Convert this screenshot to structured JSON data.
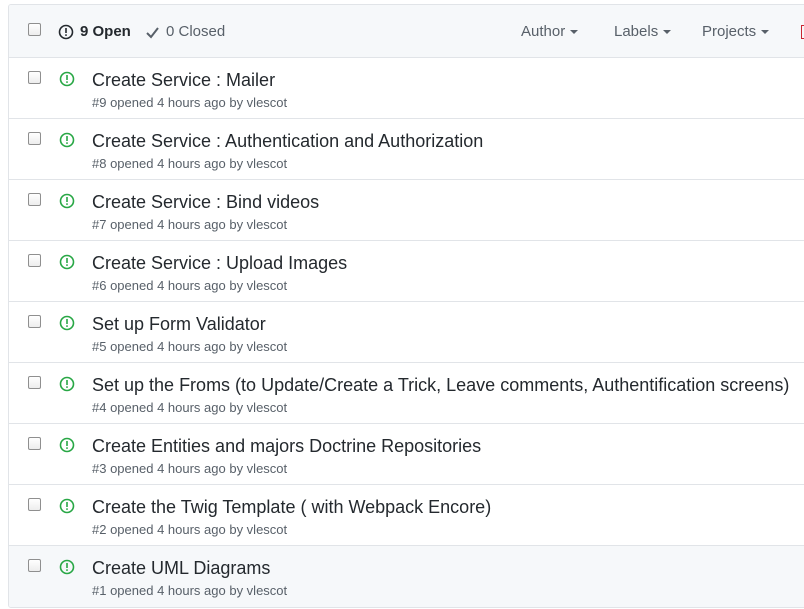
{
  "header": {
    "open_label": "9 Open",
    "closed_label": "0 Closed",
    "filters": {
      "author": "Author",
      "labels": "Labels",
      "projects": "Projects"
    }
  },
  "colors": {
    "open_icon": "#28a745",
    "header_bg": "#f6f8fa",
    "border": "#e1e4e8",
    "meta_text": "#586069"
  },
  "icons": {
    "header_state": "issue-opened-icon",
    "closed_state": "check-icon",
    "issue": "issue-opened-icon"
  },
  "issues": [
    {
      "title": "Create Service : Mailer",
      "meta": "#9 opened 4 hours ago by vlescot"
    },
    {
      "title": "Create Service : Authentication and Authorization",
      "meta": "#8 opened 4 hours ago by vlescot"
    },
    {
      "title": "Create Service : Bind videos",
      "meta": "#7 opened 4 hours ago by vlescot"
    },
    {
      "title": "Create Service : Upload Images",
      "meta": "#6 opened 4 hours ago by vlescot"
    },
    {
      "title": "Set up Form Validator",
      "meta": "#5 opened 4 hours ago by vlescot"
    },
    {
      "title": "Set up the Froms (to Update/Create a Trick, Leave comments, Authentification screens)",
      "meta": "#4 opened 4 hours ago by vlescot"
    },
    {
      "title": "Create Entities and majors Doctrine Repositories",
      "meta": "#3 opened 4 hours ago by vlescot"
    },
    {
      "title": "Create the Twig Template ( with Webpack Encore)",
      "meta": "#2 opened 4 hours ago by vlescot"
    },
    {
      "title": "Create UML Diagrams",
      "meta": "#1 opened 4 hours ago by vlescot"
    }
  ]
}
